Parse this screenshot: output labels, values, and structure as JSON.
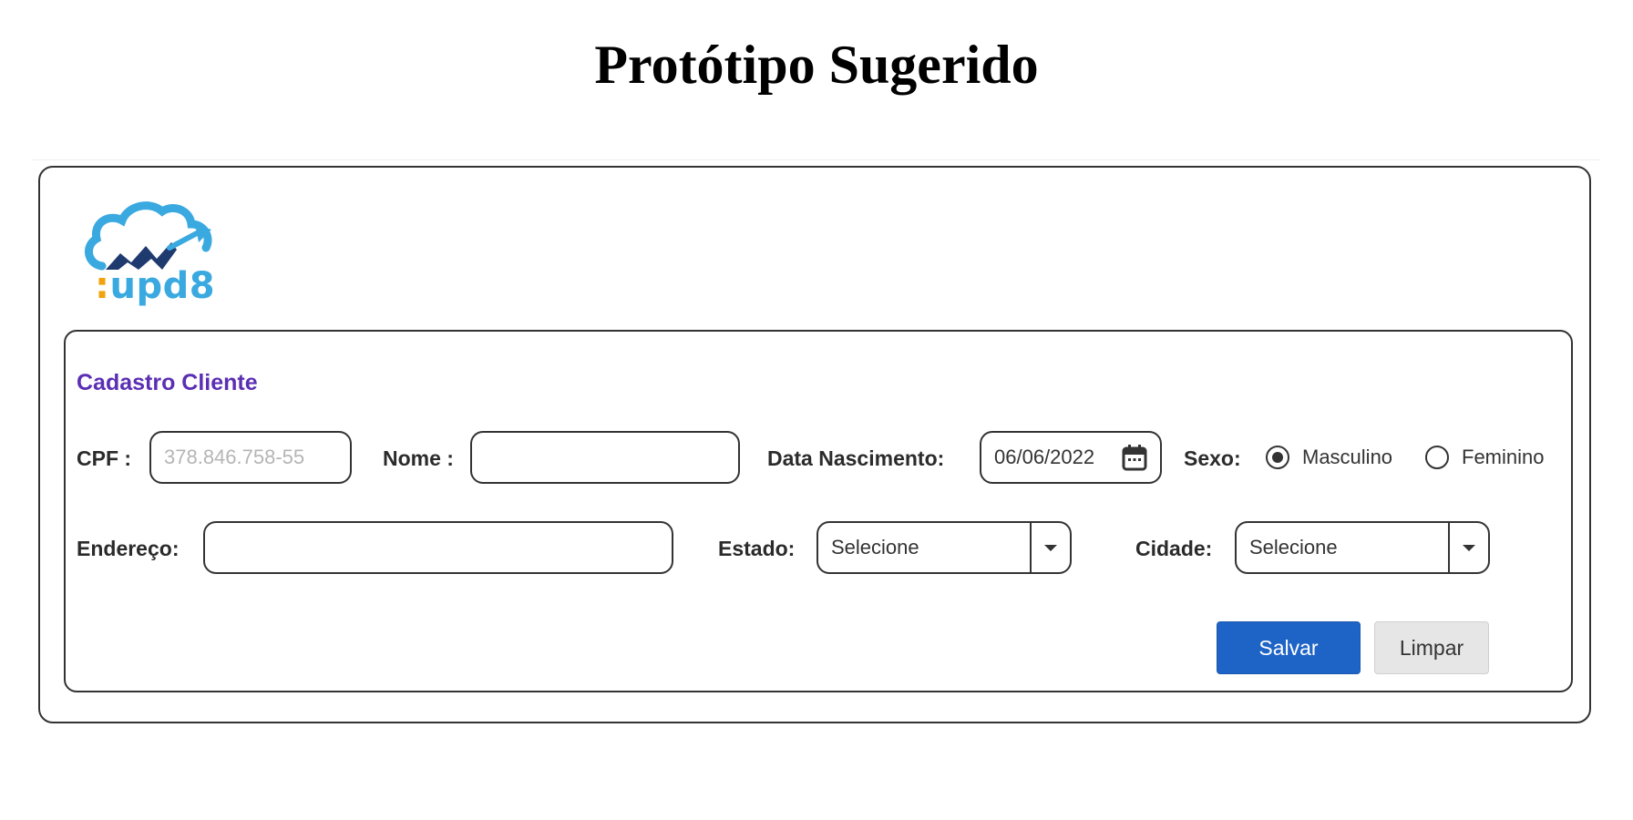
{
  "page": {
    "title": "Protótipo Sugerido"
  },
  "logo": {
    "colon": ":",
    "text": "upd8"
  },
  "form": {
    "title": "Cadastro Cliente",
    "cpf": {
      "label": "CPF :",
      "placeholder": "378.846.758-55",
      "value": ""
    },
    "nome": {
      "label": "Nome :",
      "value": ""
    },
    "data_nascimento": {
      "label": "Data Nascimento:",
      "value": "06/06/2022"
    },
    "sexo": {
      "label": "Sexo:",
      "options": [
        {
          "label": "Masculino",
          "selected": true
        },
        {
          "label": "Feminino",
          "selected": false
        }
      ]
    },
    "endereco": {
      "label": "Endereço:",
      "value": ""
    },
    "estado": {
      "label": "Estado:",
      "selected": "Selecione"
    },
    "cidade": {
      "label": "Cidade:",
      "selected": "Selecione"
    },
    "buttons": {
      "save": "Salvar",
      "clear": "Limpar"
    }
  },
  "colors": {
    "section_title": "#5b2fb3",
    "primary_button": "#1e63c6",
    "secondary_button": "#e6e6e6",
    "logo_blue": "#3aa9e0",
    "logo_navy": "#1f3a6e",
    "logo_orange": "#f2a20c"
  },
  "icons": [
    "calendar-icon",
    "dropdown-arrow-icon",
    "cloud-logo-icon"
  ]
}
